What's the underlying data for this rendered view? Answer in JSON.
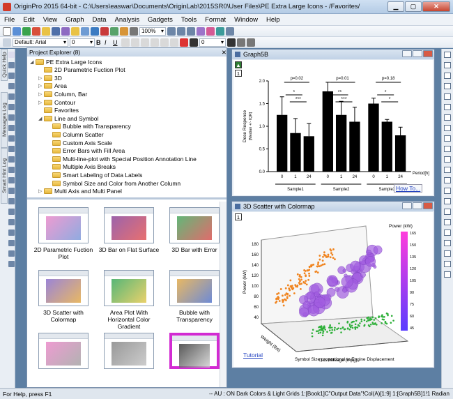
{
  "window": {
    "title": "OriginPro 2015 64-bit - C:\\Users\\easwar\\Documents\\OriginLab\\2015SR0\\User Files\\PE Extra Large Icons - /Favorites/"
  },
  "menu": [
    "File",
    "Edit",
    "View",
    "Graph",
    "Data",
    "Analysis",
    "Gadgets",
    "Tools",
    "Format",
    "Window",
    "Help"
  ],
  "toolbar": {
    "zoom": "100%",
    "font_name": "Default: Arial",
    "font_size": "0",
    "size2": "0"
  },
  "side_tabs": [
    "Quick Help",
    "Messages Log",
    "Smart Hint Log"
  ],
  "project_explorer": {
    "title": "Project Explorer (8)",
    "tree": [
      {
        "label": "PE Extra Large Icons",
        "level": 0,
        "arrow": "◢"
      },
      {
        "label": "2D Parametric Fuction Plot",
        "level": 1,
        "arrow": ""
      },
      {
        "label": "3D",
        "level": 1,
        "arrow": "▷"
      },
      {
        "label": "Area",
        "level": 1,
        "arrow": "▷"
      },
      {
        "label": "Column, Bar",
        "level": 1,
        "arrow": "▷"
      },
      {
        "label": "Contour",
        "level": 1,
        "arrow": "▷"
      },
      {
        "label": "Favorites",
        "level": 1,
        "arrow": ""
      },
      {
        "label": "Line and Symbol",
        "level": 1,
        "arrow": "◢"
      },
      {
        "label": "Bubble with Transparency",
        "level": 2,
        "arrow": ""
      },
      {
        "label": "Column Scatter",
        "level": 2,
        "arrow": ""
      },
      {
        "label": "Custom Axis Scale",
        "level": 2,
        "arrow": ""
      },
      {
        "label": "Error Bars with Fill Area",
        "level": 2,
        "arrow": ""
      },
      {
        "label": "Multi-line-plot with Special Position Annotation Line",
        "level": 2,
        "arrow": ""
      },
      {
        "label": "Multiple Axis Breaks",
        "level": 2,
        "arrow": ""
      },
      {
        "label": "Smart Labeling of Data Labels",
        "level": 2,
        "arrow": ""
      },
      {
        "label": "Symbol Size and Color from Another Column",
        "level": 2,
        "arrow": ""
      },
      {
        "label": "Multi Axis and Multi Panel",
        "level": 1,
        "arrow": "▷"
      }
    ],
    "thumbnails": [
      {
        "label": "2D Parametric Fuction Plot"
      },
      {
        "label": "3D Bar on Flat Surface"
      },
      {
        "label": "3D Bar with Error"
      },
      {
        "label": "3D Scatter with Colormap"
      },
      {
        "label": "Area Plot With Horizontal Color Gradient"
      },
      {
        "label": "Bubble with Transparency"
      },
      {
        "label": ""
      },
      {
        "label": ""
      },
      {
        "label": ""
      }
    ]
  },
  "graph5b": {
    "title": "Graph5B",
    "layer": "1",
    "link": "How To...",
    "chart_data": {
      "type": "bar",
      "ylabel": "Dose Response\n[Median +/- IQR]",
      "ylim": [
        0,
        2
      ],
      "yticks": [
        "0.0",
        "0.5",
        "1.0",
        "1.5",
        "2.0"
      ],
      "period_label": "Period[h]",
      "categories": [
        "0",
        "1",
        "24",
        "0",
        "1",
        "24",
        "0",
        "1",
        "24"
      ],
      "groups": [
        "Sample1",
        "Sample2",
        "Sample3"
      ],
      "values": [
        1.25,
        0.85,
        0.78,
        1.77,
        1.25,
        1.1,
        1.5,
        1.1,
        0.8
      ],
      "errors": [
        0.4,
        0.32,
        0.28,
        0.2,
        0.3,
        0.32,
        0.12,
        0.05,
        0.18
      ],
      "pvalues": [
        "p=0.02",
        "p=0.01",
        "p=0.18"
      ],
      "sig": [
        "*",
        "***",
        "**",
        "***",
        "*",
        "*"
      ]
    }
  },
  "scatter3d": {
    "title": "3D Scatter with Colormap",
    "layer": "1",
    "link": "Tutorial",
    "caption": "Symbol Size proportional to Engine Displacement",
    "chart_data": {
      "type": "scatter",
      "zlabel": "Power (kW)",
      "xlabel": "Gas Mileage (mpg)",
      "ylabel": "Weight (lbs)",
      "colorbar_title": "Power (kW)",
      "colorbar_ticks": [
        "165",
        "150",
        "135",
        "120",
        "105",
        "90",
        "75",
        "60",
        "45"
      ],
      "zticks": [
        "180",
        "160",
        "140",
        "120",
        "100",
        "80",
        "60",
        "40"
      ]
    }
  },
  "status": {
    "left": "For Help, press F1",
    "right": "-- AU : ON  Dark Colors & Light Grids  1:[Book1]C\"Output Data\"!Col(A)[1:9]  1:[Graph5B]1!1  Radian"
  }
}
